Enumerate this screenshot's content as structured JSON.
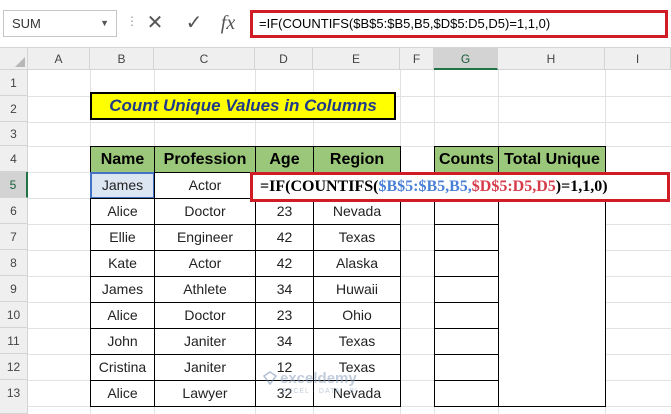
{
  "namebox": {
    "value": "SUM"
  },
  "formula_bar": {
    "cancel_icon": "✕",
    "enter_icon": "✓",
    "fx_icon": "fx",
    "formula": "=IF(COUNTIFS($B$5:$B5,B5,$D$5:D5,D5)=1,1,0)"
  },
  "columns": [
    "A",
    "B",
    "C",
    "D",
    "E",
    "F",
    "G",
    "H",
    "I"
  ],
  "rows": [
    "1",
    "2",
    "3",
    "4",
    "5",
    "6",
    "7",
    "8",
    "9",
    "10",
    "11",
    "12",
    "13"
  ],
  "title": "Count Unique Values in Columns",
  "table": {
    "headers": [
      "Name",
      "Profession",
      "Age",
      "Region"
    ],
    "rows": [
      [
        "James",
        "Actor",
        "",
        ""
      ],
      [
        "Alice",
        "Doctor",
        "23",
        "Nevada"
      ],
      [
        "Ellie",
        "Engineer",
        "42",
        "Texas"
      ],
      [
        "Kate",
        "Actor",
        "42",
        "Alaska"
      ],
      [
        "James",
        "Athlete",
        "34",
        "Huwaii"
      ],
      [
        "Alice",
        "Doctor",
        "23",
        "Ohio"
      ],
      [
        "John",
        "Janiter",
        "34",
        "Texas"
      ],
      [
        "Cristina",
        "Janiter",
        "12",
        "Texas"
      ],
      [
        "Alice",
        "Lawyer",
        "32",
        "Nevada"
      ]
    ]
  },
  "counts_table": {
    "headers": [
      "Counts",
      "Total Unique"
    ]
  },
  "cell_formula": {
    "p1": "=IF(COUNTIFS(",
    "p2": "$B$5:$B5",
    "p3": ",B5,",
    "p4": "$D$5:D5",
    "p5": ",D5",
    "p6": ")=1,1,0)"
  },
  "watermark": {
    "text": "exceldemy",
    "sub": "EXCEL · DATA · BI"
  }
}
